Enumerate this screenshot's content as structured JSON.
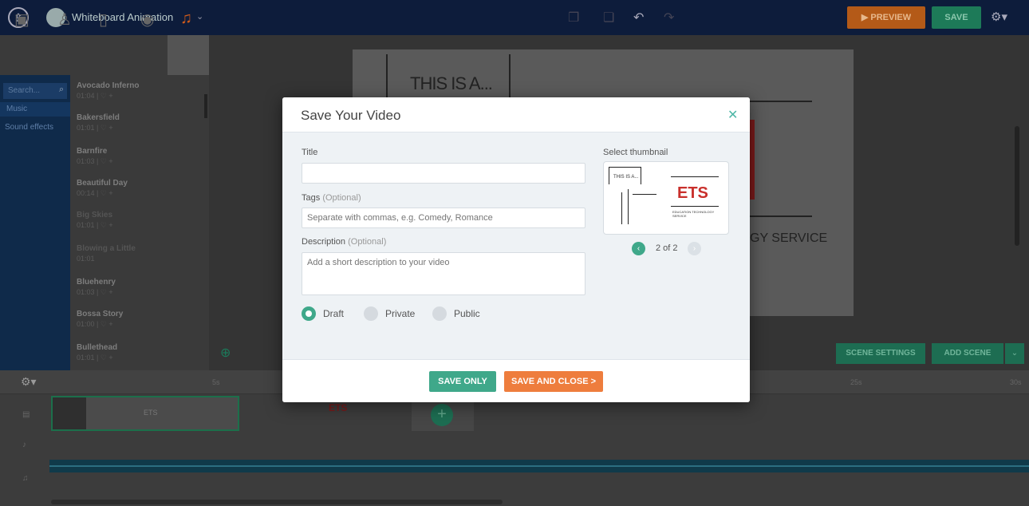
{
  "app": {
    "project_title": "Whiteboard Animation",
    "preview_label": "PREVIEW",
    "save_label": "SAVE"
  },
  "sidebar": {
    "search_placeholder": "Search...",
    "categories": [
      "Music",
      "Sound effects"
    ]
  },
  "tracks": [
    {
      "name": "Avocado Inferno",
      "meta": "01:04 | ♡ +"
    },
    {
      "name": "Bakersfield",
      "meta": "01:01 | ♡ +"
    },
    {
      "name": "Barnfire",
      "meta": "01:03 | ♡ +"
    },
    {
      "name": "Beautiful Day",
      "meta": "00:14 | ♡ +"
    },
    {
      "name": "Big Skies",
      "meta": "01:01 | ♡ +"
    },
    {
      "name": "Blowing a Little",
      "meta": "01:01"
    },
    {
      "name": "Bluehenry",
      "meta": "01:03 | ♡ +"
    },
    {
      "name": "Bossa Story",
      "meta": "01:00 | ♡ +"
    },
    {
      "name": "Bullethead",
      "meta": "01:01 | ♡ +"
    }
  ],
  "canvas": {
    "text_top": "THIS IS A...",
    "text_right": "GY SERVICE"
  },
  "scene_toolbar": {
    "scene_settings": "SCENE SETTINGS",
    "add_scene": "ADD SCENE"
  },
  "timeline": {
    "ticks": [
      "5s",
      "25s",
      "30s"
    ],
    "scene1_label": "ETS",
    "scene2_label": "ETS"
  },
  "modal": {
    "title": "Save Your Video",
    "title_label": "Title",
    "title_value": "",
    "tags_label": "Tags",
    "tags_optional": "(Optional)",
    "tags_placeholder": "Separate with commas, e.g. Comedy, Romance",
    "description_label": "Description",
    "description_optional": "(Optional)",
    "description_placeholder": "Add a short description to your video",
    "thumbnail_label": "Select thumbnail",
    "thumbnail_pager": "2 of 2",
    "thumb_ets": "ETS",
    "thumb_sub": "EDUCATION TECHNOLOGY SERVICE",
    "thumb_this": "THIS IS A...",
    "privacy": {
      "selected": "Draft",
      "options": [
        "Draft",
        "Private",
        "Public"
      ]
    },
    "save_only": "SAVE ONLY",
    "save_and_close": "SAVE AND CLOSE >"
  },
  "colors": {
    "teal": "#3fa88a",
    "orange": "#ee7d3d",
    "topbar": "#0d1c3b"
  }
}
